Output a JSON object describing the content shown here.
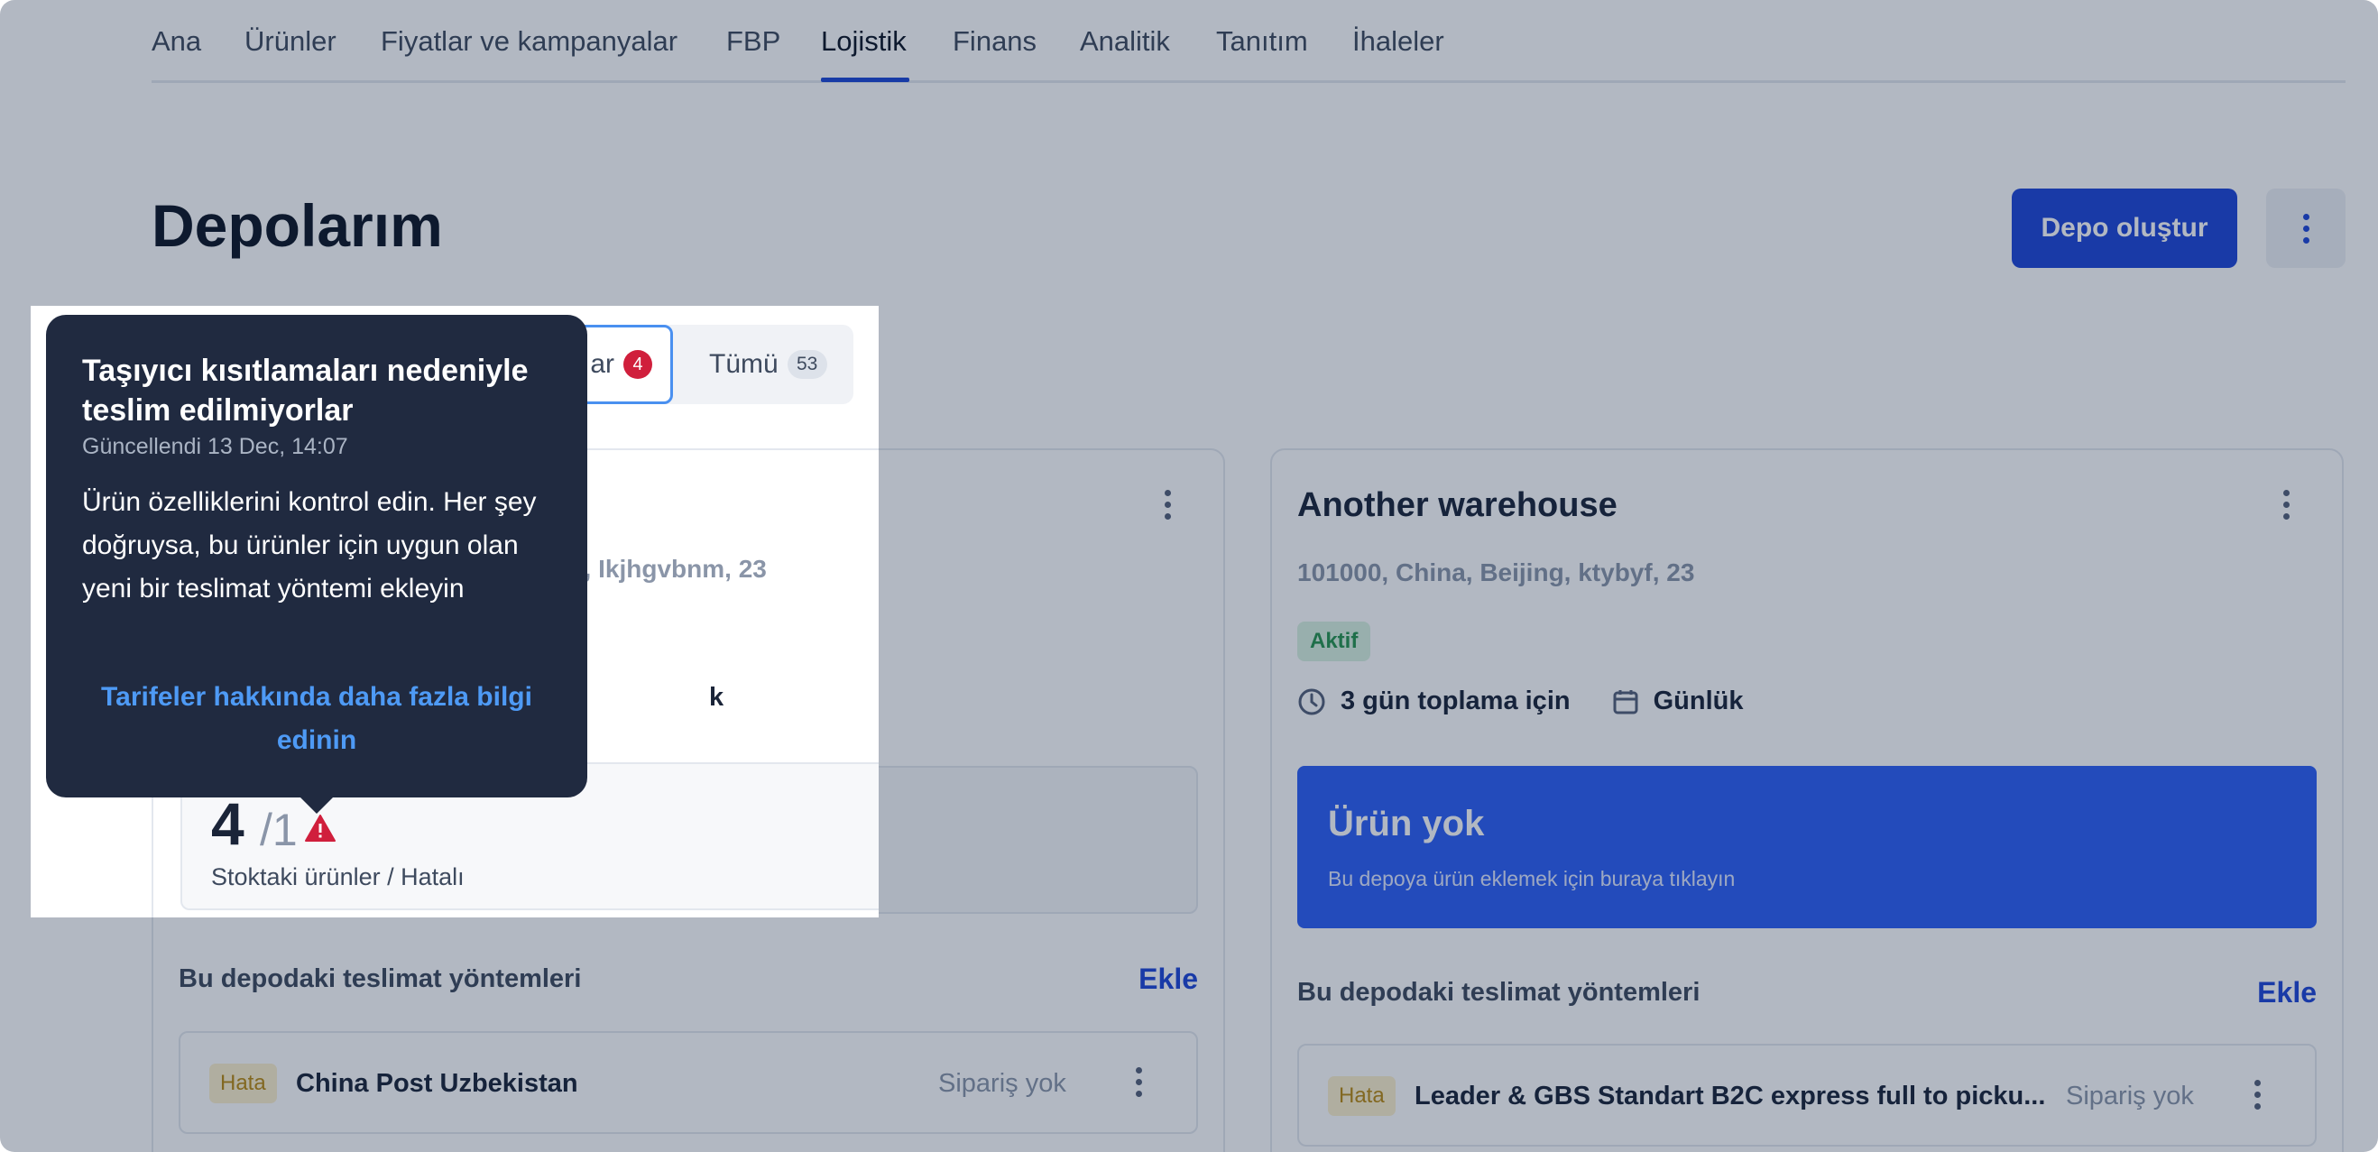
{
  "nav": {
    "items": [
      "Ana",
      "Ürünler",
      "Fiyatlar ve kampanyalar",
      "FBP",
      "Lojistik",
      "Finans",
      "Analitik",
      "Tanıtım",
      "İhaleler"
    ],
    "active": "Lojistik"
  },
  "header": {
    "title": "Depolarım",
    "create_button": "Depo oluştur",
    "more_icon": "vertical-dots-icon"
  },
  "tabs": {
    "problem_label": "ar",
    "problem_count": "4",
    "all_label": "Tümü",
    "all_count": "53"
  },
  "cards": [
    {
      "title": "",
      "address": "ghai, Ikjhgvbnm, 23",
      "meta_schedule": "k",
      "stock": {
        "in_stock": "4",
        "errors": "/1",
        "label": "Stoktaki ürünler / Hatalı"
      },
      "delivery": {
        "title": "Bu depodaki teslimat yöntemleri",
        "add_label": "Ekle",
        "rows": [
          {
            "status": "Hata",
            "name": "China Post Uzbekistan",
            "orders": "Sipariş yok"
          }
        ]
      }
    },
    {
      "title": "Another warehouse",
      "address": "101000, China, Beijing, ktybyf, 23",
      "status": "Aktif",
      "meta_picking": "3 gün toplama için",
      "meta_schedule": "Günlük",
      "empty": {
        "title": "Ürün yok",
        "subtitle": "Bu depoya ürün eklemek için buraya tıklayın"
      },
      "delivery": {
        "title": "Bu depodaki teslimat yöntemleri",
        "add_label": "Ekle",
        "rows": [
          {
            "status": "Hata",
            "name": "Leader & GBS Standart B2C express full to picku...",
            "orders": "Sipariş yok"
          }
        ]
      }
    }
  ],
  "tooltip": {
    "title": "Taşıyıcı kısıtlamaları nedeniyle teslim edilmiyorlar",
    "updated": "Güncellendi 13 Dec, 14:07",
    "body": "Ürün özelliklerini kontrol edin. Her şey doğruysa, bu ürünler için uygun olan yeni bir teslimat yöntemi ekleyin",
    "link": "Tarifeler hakkında daha fazla bilgi edinin"
  },
  "colors": {
    "accent": "#1e46d8",
    "tooltip_bg": "#202a40",
    "link": "#4e9af5",
    "error_red": "#d01f3c",
    "active_green": "#27944f"
  }
}
